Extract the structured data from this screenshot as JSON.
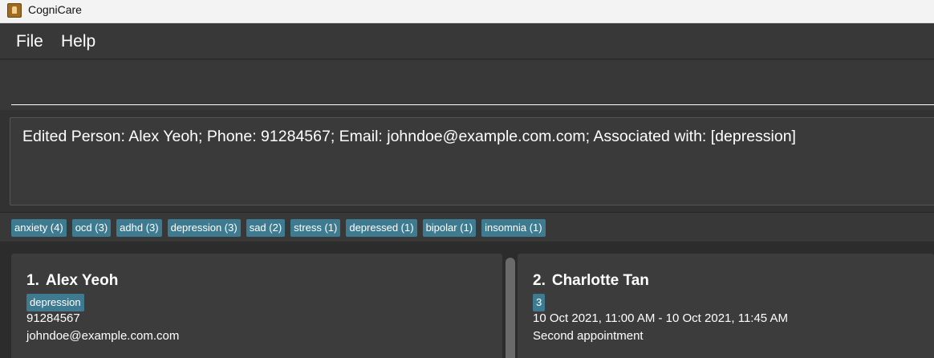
{
  "window": {
    "title": "CogniCare"
  },
  "menu": {
    "items": [
      "File",
      "Help"
    ]
  },
  "command": {
    "value": "",
    "placeholder": ""
  },
  "result": {
    "message": "Edited Person: Alex Yeoh; Phone: 91284567; Email: johndoe@example.com.com; Associated with: [depression]"
  },
  "tags": [
    "anxiety (4)",
    "ocd (3)",
    "adhd (3)",
    "depression (3)",
    "sad (2)",
    "stress (1)",
    "depressed (1)",
    "bipolar (1)",
    "insomnia (1)"
  ],
  "cards": [
    {
      "index": "1.",
      "name": "Alex Yeoh",
      "tag": "depression",
      "line1": "91284567",
      "line2": "johndoe@example.com.com"
    },
    {
      "index": "2.",
      "name": "Charlotte Tan",
      "tag": "3",
      "line1": "10 Oct 2021, 11:00 AM - 10 Oct 2021, 11:45 AM",
      "line2": "Second appointment"
    }
  ],
  "colors": {
    "background": "#323232",
    "tag": "#3e7b91",
    "card": "#3c3c3c",
    "text": "#ffffff"
  }
}
